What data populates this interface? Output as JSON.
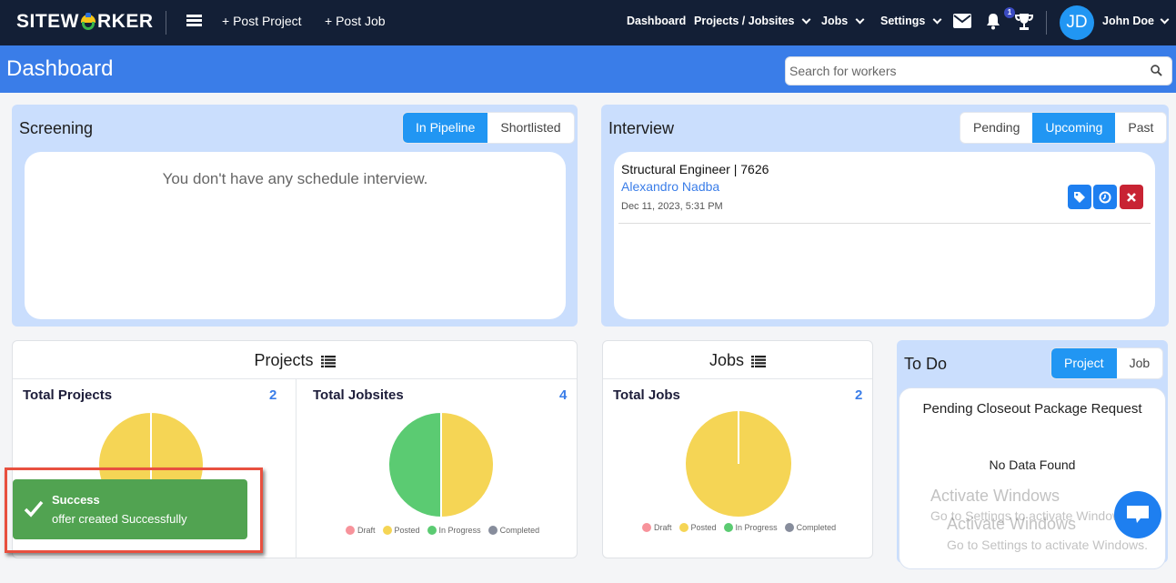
{
  "topbar": {
    "logo": "SITEWORKER",
    "logo_left": "SITEW",
    "logo_right": "RKER",
    "post_project": "+ Post Project",
    "post_job": "+ Post Job",
    "nav": [
      {
        "label": "Dashboard",
        "has_dropdown": false
      },
      {
        "label": "Projects / Jobsites",
        "has_dropdown": true
      },
      {
        "label": "Jobs",
        "has_dropdown": true
      },
      {
        "label": "Settings",
        "has_dropdown": true
      }
    ],
    "notification_count": "1",
    "avatar_initials": "JD",
    "user_name": "John Doe",
    "icons": [
      "menu-icon",
      "mail-icon",
      "bell-icon",
      "trophy-icon",
      "chevron-down-icon"
    ]
  },
  "header": {
    "title": "Dashboard",
    "search_placeholder": "Search for workers"
  },
  "screening": {
    "title": "Screening",
    "tabs": [
      {
        "label": "In Pipeline",
        "active": true
      },
      {
        "label": "Shortlisted",
        "active": false
      }
    ],
    "empty_message": "You don't have any schedule interview."
  },
  "interview": {
    "title": "Interview",
    "tabs": [
      {
        "label": "Pending",
        "active": false
      },
      {
        "label": "Upcoming",
        "active": true
      },
      {
        "label": "Past",
        "active": false
      }
    ],
    "items": [
      {
        "title": "Structural Engineer | 7626",
        "candidate": "Alexandro Nadba",
        "datetime": "Dec 11, 2023, 5:31 PM",
        "actions": [
          "tag-icon",
          "clock-icon",
          "close-icon"
        ]
      }
    ]
  },
  "projects_card": {
    "title": "Projects",
    "total_projects_label": "Total Projects",
    "total_projects_value": "2",
    "total_jobsites_label": "Total Jobsites",
    "total_jobsites_value": "4"
  },
  "jobs_card": {
    "title": "Jobs",
    "total_jobs_label": "Total Jobs",
    "total_jobs_value": "2"
  },
  "todo": {
    "title": "To Do",
    "tabs": [
      {
        "label": "Project",
        "active": true
      },
      {
        "label": "Job",
        "active": false
      }
    ],
    "section_title": "Pending Closeout Package Request",
    "empty_message": "No Data Found"
  },
  "legend": {
    "labels": [
      "Draft",
      "Posted",
      "In Progress",
      "Completed"
    ],
    "colors": [
      "#f7939b",
      "#f5d555",
      "#5bcb72",
      "#878d9c"
    ]
  },
  "chart_data": [
    {
      "type": "pie",
      "title": "Total Projects",
      "categories": [
        "Draft",
        "Posted",
        "In Progress",
        "Completed"
      ],
      "slices": [
        {
          "label": "Posted",
          "value": 1,
          "color": "#f5d555"
        },
        {
          "label": "Posted",
          "value": 1,
          "color": "#f5d555"
        }
      ],
      "total": 2
    },
    {
      "type": "pie",
      "title": "Total Jobsites",
      "categories": [
        "Draft",
        "Posted",
        "In Progress",
        "Completed"
      ],
      "slices": [
        {
          "label": "Posted",
          "value": 2,
          "color": "#f5d555"
        },
        {
          "label": "In Progress",
          "value": 2,
          "color": "#5bcb72"
        }
      ],
      "total": 4
    },
    {
      "type": "pie",
      "title": "Total Jobs",
      "categories": [
        "Draft",
        "Posted",
        "In Progress",
        "Completed"
      ],
      "slices": [
        {
          "label": "Posted",
          "value": 2,
          "color": "#f5d555"
        }
      ],
      "total": 2
    }
  ],
  "toast": {
    "title": "Success",
    "message": "offer created Successfully"
  },
  "watermark": {
    "line1": "Activate Windows",
    "line2": "Go to Settings to activate Windows."
  },
  "colors": {
    "topbar": "#131f36",
    "header": "#3a7de8",
    "accent": "#2196f3",
    "success": "#51a351",
    "danger": "#c82333"
  }
}
